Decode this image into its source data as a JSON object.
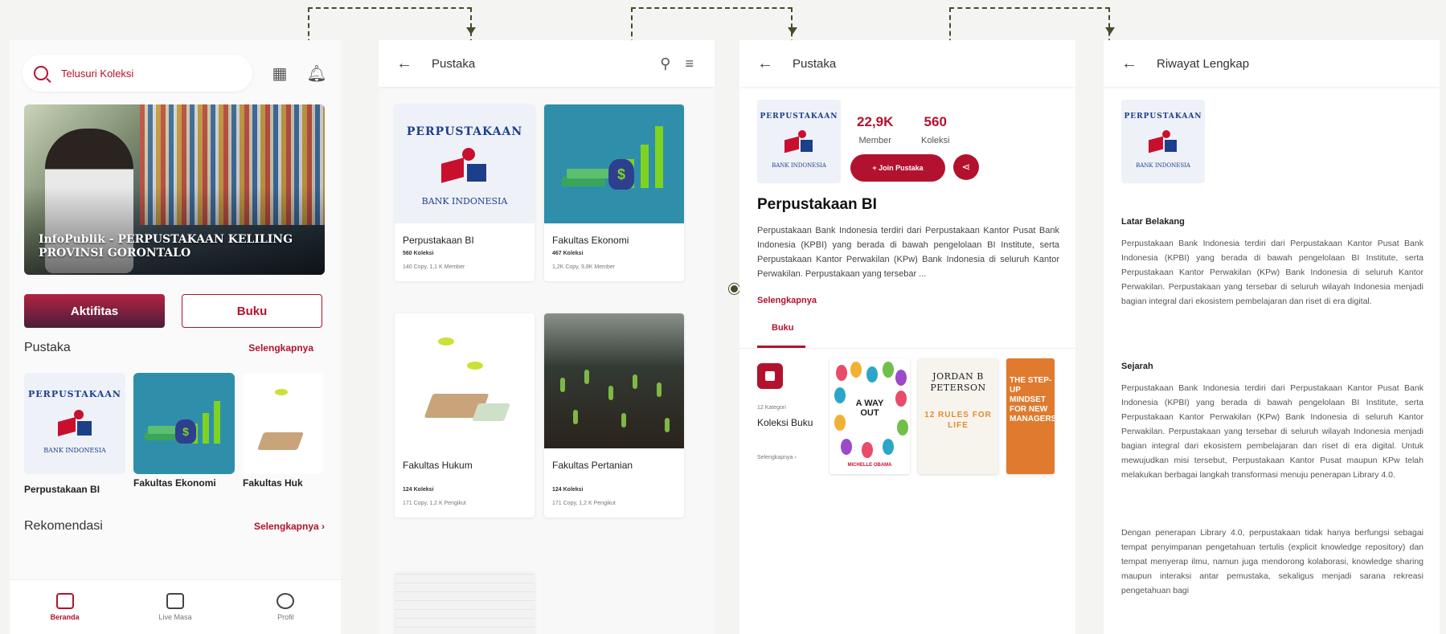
{
  "home": {
    "search_placeholder": "Telusuri Koleksi",
    "qr_icon": "qr-code-icon",
    "bell_icon": "bell-icon",
    "banner_caption": "InfoPublik - PERPUSTAKAAN KELILING PROVINSI GORONTALO",
    "tabs": [
      "Aktifitas",
      "Buku"
    ],
    "pustaka_heading": "Pustaka",
    "pustaka_more": "Selengkapnya",
    "pustaka_items": [
      "Perpustakaan BI",
      "Fakultas Ekonomi",
      "Fakultas Huk"
    ],
    "rekomendasi_heading": "Rekomendasi",
    "rekomendasi_more": "Selengkapnya ›",
    "nav": [
      {
        "label": "Beranda",
        "icon": "home-icon"
      },
      {
        "label": "Live Masa",
        "icon": "play-icon"
      },
      {
        "label": "Profil",
        "icon": "user-icon"
      }
    ]
  },
  "list": {
    "title": "Pustaka",
    "cards": [
      {
        "name": "Perpustakaan BI",
        "koleksi": "560 Koleksi",
        "copy": "140 Copy, 1,1 K Member"
      },
      {
        "name": "Fakultas Ekonomi",
        "koleksi": "467 Koleksi",
        "copy": "1,2K Copy, 9,8K Member"
      },
      {
        "name": "Fakultas Hukum",
        "koleksi": "124 Koleksi",
        "copy": "171 Copy, 1,2 K Pengikut"
      },
      {
        "name": "Fakultas Pertanian",
        "koleksi": "124 Koleksi",
        "copy": "171 Copy, 1,2 K Pengikut"
      }
    ]
  },
  "detail": {
    "title": "Pustaka",
    "member_value": "22,9K",
    "member_label": "Member",
    "koleksi_value": "560",
    "koleksi_label": "Koleksi",
    "join_label": "+ Join Pustaka",
    "name": "Perpustakaan BI",
    "description": "Perpustakaan Bank Indonesia terdiri dari Perpustakaan Kantor Pusat Bank Indonesia (KPBI) yang berada di bawah pengelolaan BI Institute, serta Perpustakaan Kantor Perwakilan (KPw) Bank Indonesia di seluruh Kantor Perwakilan. Perpustakaan yang tersebar ...",
    "more": "Selengkapnya",
    "tab": "Buku",
    "kategori": "12 Kategori",
    "koleksi_buku": "Koleksi Buku",
    "selengkapnya_small": "Selengkapnya   ›",
    "book1_title": "A WAY OUT",
    "book1_author": "MICHELLE OBAMA",
    "book2_author": "JORDAN B PETERSON",
    "book2_title": "12 RULES FOR LIFE",
    "book3_title": "THE STEP-UP MINDSET FOR NEW MANAGERS"
  },
  "history": {
    "title": "Riwayat Lengkap",
    "latar_heading": "Latar Belakang",
    "latar_text": "Perpustakaan Bank Indonesia terdiri dari Perpustakaan Kantor Pusat Bank Indonesia (KPBI) yang berada di bawah pengelolaan BI Institute, serta Perpustakaan Kantor Perwakilan (KPw) Bank Indonesia di seluruh Kantor Perwakilan. Perpustakaan yang tersebar di seluruh wilayah Indonesia menjadi bagian integral dari ekosistem pembelajaran dan riset di era digital.",
    "sejarah_heading": "Sejarah",
    "sejarah_text1": "Perpustakaan Bank Indonesia terdiri dari Perpustakaan Kantor Pusat Bank Indonesia (KPBI) yang berada di bawah pengelolaan BI Institute, serta Perpustakaan Kantor Perwakilan (KPw) Bank Indonesia di seluruh Kantor Perwakilan. Perpustakaan yang tersebar di seluruh wilayah Indonesia menjadi bagian integral dari ekosistem pembelajaran dan riset di era digital. Untuk mewujudkan misi tersebut, Perpustakaan Kantor Pusat maupun KPw telah melakukan berbagai langkah transformasi menuju penerapan Library 4.0.",
    "sejarah_text2": "Dengan penerapan Library 4.0, perpustakaan tidak hanya berfungsi sebagai tempat penyimpanan pengetahuan tertulis (explicit knowledge repository) dan tempat menyerap ilmu, namun juga mendorong kolaborasi, knowledge sharing maupun interaksi antar pemustaka, sekaligus menjadi sarana rekreasi pengetahuan bagi"
  },
  "logo": {
    "arc_text": "PERPUSTAKAAN",
    "sub_text": "BANK INDONESIA"
  },
  "colors": {
    "primary": "#b3122e",
    "connector": "#4a4a2a",
    "logo_blue": "#1c3f8a"
  }
}
